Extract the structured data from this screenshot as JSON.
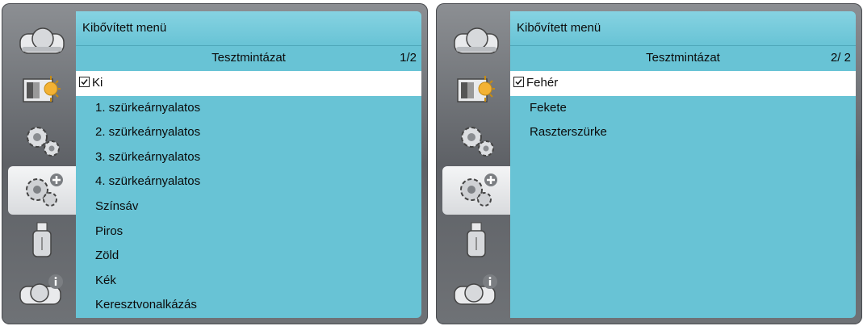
{
  "panels": [
    {
      "menu_title": "Kibővített menü",
      "submenu_title": "Tesztmintázat",
      "page_indicator": "1/2",
      "selected_index": 0,
      "items": [
        {
          "label": "Ki"
        },
        {
          "label": "1. szürkeárnyalatos"
        },
        {
          "label": "2. szürkeárnyalatos"
        },
        {
          "label": "3. szürkeárnyalatos"
        },
        {
          "label": "4. szürkeárnyalatos"
        },
        {
          "label": "Színsáv"
        },
        {
          "label": "Piros"
        },
        {
          "label": "Zöld"
        },
        {
          "label": "Kék"
        },
        {
          "label": "Keresztvonalkázás"
        }
      ]
    },
    {
      "menu_title": "Kibővített menü",
      "submenu_title": "Tesztmintázat",
      "page_indicator": "2/ 2",
      "selected_index": 0,
      "items": [
        {
          "label": "Fehér"
        },
        {
          "label": "Fekete"
        },
        {
          "label": "Raszterszürke"
        }
      ]
    }
  ],
  "sidebar": {
    "icons": [
      "projector-icon",
      "picture-brightness-icon",
      "settings-gears-icon",
      "extended-settings-icon",
      "usb-drive-icon",
      "projector-info-icon"
    ],
    "active_index": 3
  },
  "colors": {
    "content_bg": "#68c3d5",
    "selected_row_bg": "#ffffff",
    "frame": "#6b6e72"
  }
}
